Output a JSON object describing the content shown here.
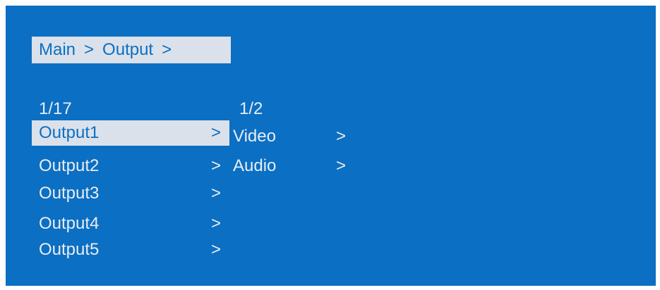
{
  "breadcrumb": {
    "items": [
      "Main",
      "Output"
    ],
    "separator": ">"
  },
  "left_menu": {
    "pager": "1/17",
    "items": [
      {
        "label": "Output1",
        "arrow": ">",
        "selected": true
      },
      {
        "label": "Output2",
        "arrow": ">"
      },
      {
        "label": "Output3",
        "arrow": ">"
      },
      {
        "label": "Output4",
        "arrow": ">"
      },
      {
        "label": "Output5",
        "arrow": ">"
      }
    ]
  },
  "right_menu": {
    "pager": "1/2",
    "items": [
      {
        "label": "Video",
        "arrow": ">"
      },
      {
        "label": "Audio",
        "arrow": ">"
      }
    ]
  },
  "colors": {
    "background": "#0b6fc3",
    "highlight": "#dbe1ea",
    "text": "#e9edf2"
  }
}
